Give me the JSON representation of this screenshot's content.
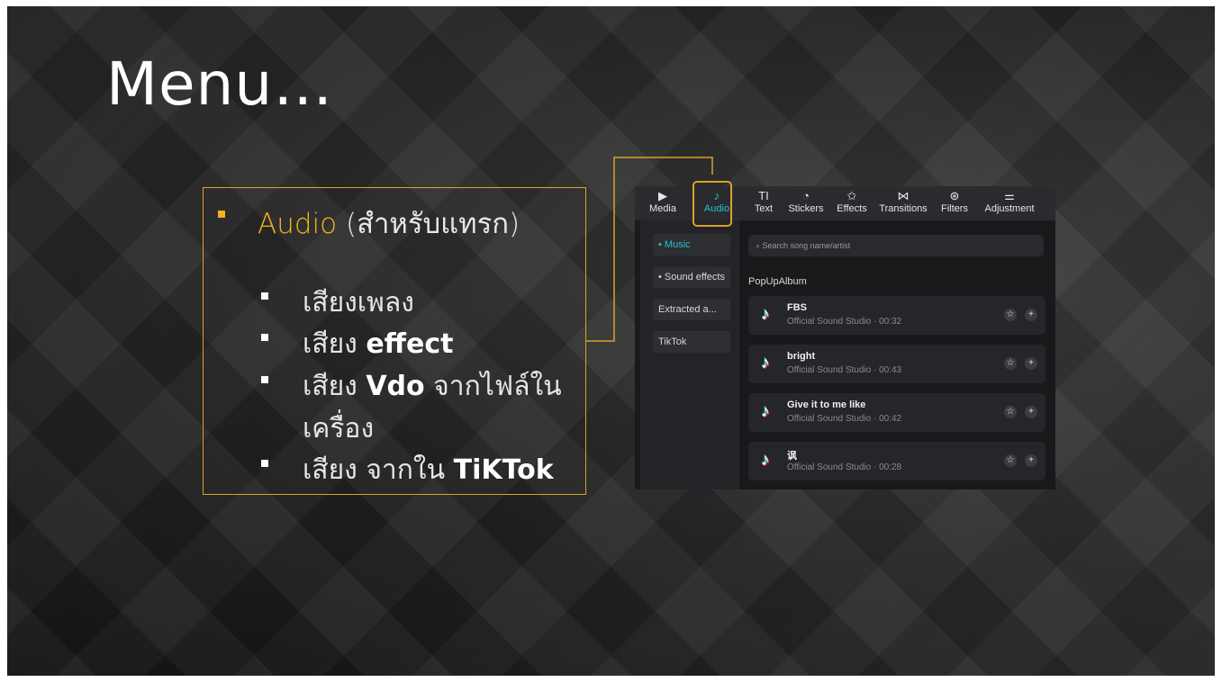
{
  "slide": {
    "title": "Menu…",
    "bullets": {
      "main_highlight": "Audio",
      "main_rest": " (สำหรับแทรก)",
      "items": [
        {
          "text": "เสียงเพลง",
          "bold": ""
        },
        {
          "text": "เสียง ",
          "bold": "effect"
        },
        {
          "text": "เสียง ",
          "bold": "Vdo",
          "after": " จากไฟล์ใน"
        },
        {
          "text": "เครื่อง",
          "bold": ""
        },
        {
          "text": "เสียง จากใน ",
          "bold": "TiKTok"
        }
      ]
    },
    "colors": {
      "accent": "#f3b21e",
      "box_border": "#d9a22a",
      "audio_active": "#22c3cf"
    }
  },
  "screenshot": {
    "toolbar": [
      {
        "label": "Media",
        "icon": "media-icon",
        "glyph": "▶"
      },
      {
        "label": "Audio",
        "icon": "audio-icon",
        "glyph": "♪"
      },
      {
        "label": "Text",
        "icon": "text-icon",
        "glyph": "TI"
      },
      {
        "label": "Stickers",
        "icon": "stickers-icon",
        "glyph": "◔"
      },
      {
        "label": "Effects",
        "icon": "effects-icon",
        "glyph": "✩"
      },
      {
        "label": "Transitions",
        "icon": "transitions-icon",
        "glyph": "⋈"
      },
      {
        "label": "Filters",
        "icon": "filters-icon",
        "glyph": "⊛"
      },
      {
        "label": "Adjustment",
        "icon": "adjustment-icon",
        "glyph": "⚌"
      }
    ],
    "sidebar": [
      {
        "label": "• Music"
      },
      {
        "label": "• Sound effects"
      },
      {
        "label": "Extracted a..."
      },
      {
        "label": "TikTok"
      }
    ],
    "search_placeholder": "Search song name/artist",
    "section": "PopUpAlbum",
    "tracks": [
      {
        "name": "FBS",
        "sub": "Official Sound Studio · 00:32"
      },
      {
        "name": "bright",
        "sub": "Official Sound Studio · 00:43"
      },
      {
        "name": "Give it to me like",
        "sub": "Official Sound Studio · 00:42"
      },
      {
        "name": "讽",
        "sub": "Official Sound Studio · 00:28"
      }
    ]
  }
}
